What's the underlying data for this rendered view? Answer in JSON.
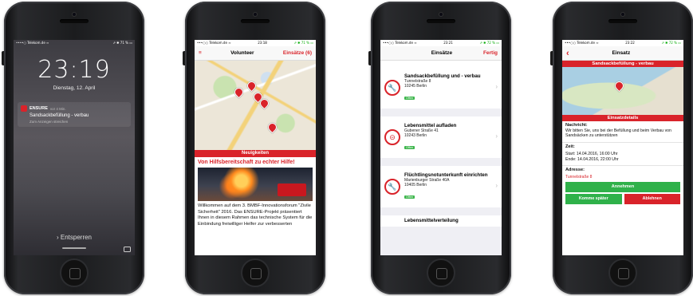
{
  "phone1": {
    "status_left": "••••○ Telekom.de ≈",
    "status_right": "⇗ ✱ 71 % ▭",
    "time": "23:19",
    "date": "Dienstag, 12. April",
    "notif_app": "ENSURE",
    "notif_ago": "vor 4 Min.",
    "notif_msg": "Sandsackbefüllung - verbau",
    "notif_sub": "Zum Anzeigen streichen",
    "unlock": "› Entsperren"
  },
  "phone2": {
    "status_left": "•••○○ Telekom.de ≈",
    "status_time": "23:18",
    "status_right": "⇗ ✱ 71 % ▭",
    "menu_icon": "≡",
    "title": "Volunteer",
    "action": "Einsätze (6)",
    "news_bar": "Neuigkeiten",
    "headline": "Von Hilfsbereitschaft zu echter Hilfe!",
    "body": "Willkommen auf dem 3. BMBF-Innovationsforum \"Zivile Sicherheit\" 2016. Das ENSURE-Projekt präsentiert Ihnen in diesem Rahmen das technische System für die Einbindung freiwilliger Helfer zur verbesserten"
  },
  "phone3": {
    "status_left": "•••○○ Telekom.de ≈",
    "status_time": "23:21",
    "status_right": "⇗ ✱ 72 % ▭",
    "title": "Einsätze",
    "action": "Fertig",
    "items": [
      {
        "title": "Sandsackbefüllung und - verbau",
        "street": "Tunnelstraße 8",
        "city": "10245 Berlin",
        "tag": "Offen",
        "icon": "🔧"
      },
      {
        "title": "Lebensmittel aufladen",
        "street": "Gubener Straße 41",
        "city": "10243 Berlin",
        "tag": "Offen",
        "icon": "⊝"
      },
      {
        "title": "Flüchtlingsnotunterkunft einrichten",
        "street": "Marienburger Straße 40A",
        "city": "10405 Berlin",
        "tag": "Offen",
        "icon": "🔧"
      },
      {
        "title": "Lebensmittelverteilung",
        "street": "",
        "city": "",
        "tag": "",
        "icon": ""
      }
    ],
    "chevron": "›"
  },
  "phone4": {
    "status_left": "•••○○ Telekom.de ≈",
    "status_time": "23:22",
    "status_right": "⇗ ✱ 72 % ▭",
    "back_icon": "‹",
    "title": "Einsatz",
    "band_top": "Sandsackbefüllung - verbau",
    "band_details": "Einsatzdetails",
    "msg_label": "Nachricht:",
    "msg_text": "Wir bitten Sie, uns bei der Befüllung und beim Verbau von Sandsäcken zu unterstützen",
    "time_label": "Zeit:",
    "start": "Start: 14.04.2016, 16:00 Uhr",
    "end": "Ende: 14.04.2016, 22:00 Uhr",
    "address_label": "Adresse:",
    "address_partial": "Tunnelstraße 8",
    "accept": "Annehmen",
    "later": "Komme später",
    "decline": "Ablehnen"
  }
}
